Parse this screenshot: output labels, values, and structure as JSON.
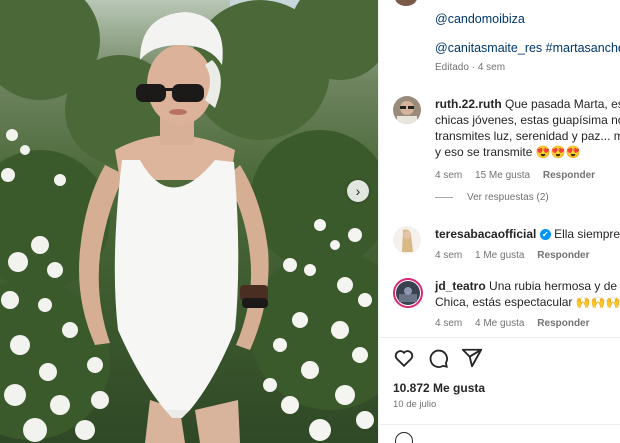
{
  "caption": {
    "tags_line1": "@candomoibiza",
    "tags_line2": "@canitasmaite_res #martasanchez #",
    "edited": "Editado",
    "edited_time": "4 sem"
  },
  "comments": [
    {
      "username": "ruth.22.ruth",
      "lines": [
        "Que pasada Marta, es c",
        "chicas jóvenes, estas guapísima no,",
        "transmites luz, serenidad y paz... me",
        "y eso se transmite"
      ],
      "emojis": "😍😍😍",
      "time": "4 sem",
      "likes": "15 Me gusta",
      "reply": "Responder",
      "view_replies": "Ver respuestas (2)"
    },
    {
      "username": "teresabacaofficial",
      "verified": "✔",
      "text": "Ella siempre D",
      "time": "4 sem",
      "likes": "1 Me gusta",
      "reply": "Responder"
    },
    {
      "username": "jd_teatro",
      "text_line1": "Una rubia hermosa y de b",
      "text_line2": "Chica, estás espectacular",
      "emojis": "🙌🙌🙌",
      "time": "4 sem",
      "likes": "4 Me gusta",
      "reply": "Responder"
    }
  ],
  "actions": {
    "like_icon": "heart-icon",
    "comment_icon": "comment-icon",
    "share_icon": "share-icon"
  },
  "post": {
    "likes": "10.872 Me gusta",
    "date": "10 de julio"
  },
  "colors": {
    "link": "#00376b",
    "muted": "#737373",
    "verified": "#0095f6"
  }
}
